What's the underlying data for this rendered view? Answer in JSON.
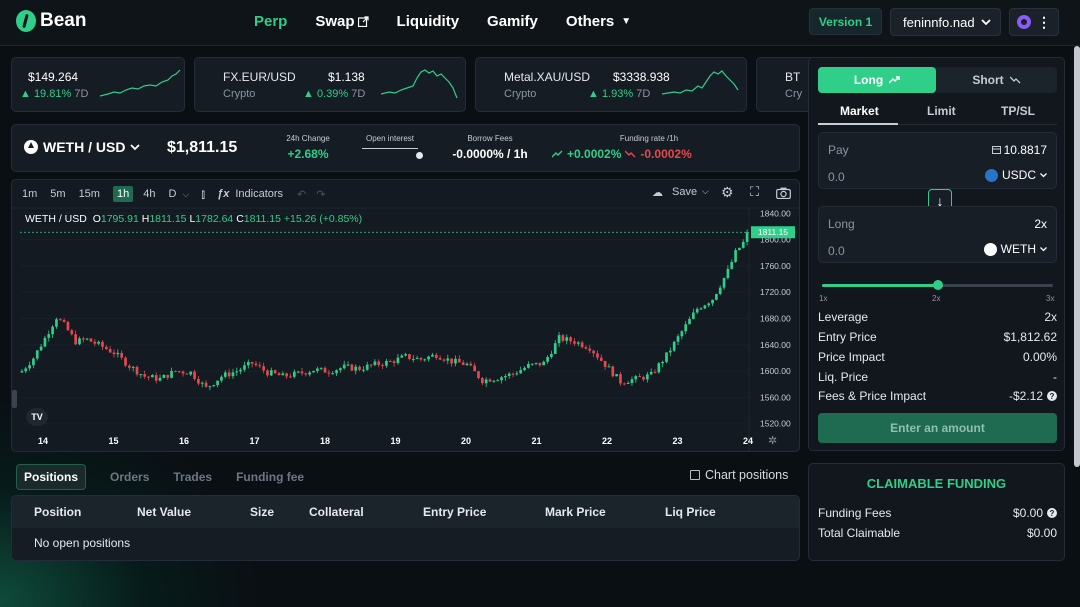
{
  "app": {
    "logo_text": "Bean"
  },
  "nav": {
    "items": [
      {
        "label": "Perp",
        "active": true
      },
      {
        "label": "Swap",
        "external": true
      },
      {
        "label": "Liquidity"
      },
      {
        "label": "Gamify"
      },
      {
        "label": "Others",
        "dropdown": true
      }
    ],
    "version": "Version 1",
    "account": "feninnfo.nad"
  },
  "tickers": [
    {
      "name": "",
      "price": "$149.264",
      "sub": "",
      "change": "▲ 19.81%",
      "period": "7D"
    },
    {
      "name": "FX.EUR/USD",
      "price": "$1.138",
      "sub": "Crypto",
      "change": "▲ 0.39%",
      "period": "7D"
    },
    {
      "name": "Metal.XAU/USD",
      "price": "$3338.938",
      "sub": "Crypto",
      "change": "▲ 1.93%",
      "period": "7D"
    },
    {
      "name": "BT",
      "price": "",
      "sub": "Cry",
      "change": "",
      "period": ""
    }
  ],
  "market": {
    "pair": "WETH / USD",
    "price": "$1,811.15",
    "stats": [
      {
        "label": "24h Change",
        "value": "+2.68%",
        "color": "#2fcf8a"
      },
      {
        "label": "Open interest",
        "value": ""
      },
      {
        "label": "Borrow Fees",
        "value": "-0.0000% / 1h",
        "color": "#ffffff"
      },
      {
        "label": "Funding rate /1h",
        "value_pos": "+0.0002%",
        "value_neg": "-0.0002%"
      }
    ]
  },
  "chart_toolbar": {
    "timeframes": [
      "1m",
      "5m",
      "15m",
      "1h",
      "4h",
      "D"
    ],
    "active_tf": "1h",
    "indicators_label": "Indicators",
    "save_label": "Save"
  },
  "chart_legend": {
    "symbol": "WETH / USD",
    "o_key": "O",
    "o": "1795.91",
    "h_key": "H",
    "h": "1811.15",
    "l_key": "L",
    "l": "1782.64",
    "c_key": "C",
    "c": "1811.15",
    "change": "+15.26 (+0.85%)"
  },
  "chart_data": {
    "type": "candlestick",
    "title": "WETH / USD",
    "x_ticks": [
      "14",
      "15",
      "16",
      "17",
      "18",
      "19",
      "20",
      "21",
      "22",
      "23",
      "24"
    ],
    "y_ticks": [
      1840,
      1800,
      1760,
      1720,
      1680,
      1640,
      1600,
      1560,
      1520
    ],
    "ylim": [
      1512,
      1848
    ],
    "last_price": 1811.15,
    "last_price_label": "1811.15",
    "close_path": [
      [
        0,
        1600
      ],
      [
        3,
        1620
      ],
      [
        6,
        1650
      ],
      [
        9,
        1682
      ],
      [
        11,
        1670
      ],
      [
        14,
        1645
      ],
      [
        17,
        1648
      ],
      [
        20,
        1640
      ],
      [
        24,
        1628
      ],
      [
        28,
        1608
      ],
      [
        32,
        1592
      ],
      [
        36,
        1588
      ],
      [
        40,
        1600
      ],
      [
        44,
        1598
      ],
      [
        48,
        1574
      ],
      [
        52,
        1592
      ],
      [
        56,
        1600
      ],
      [
        60,
        1612
      ],
      [
        64,
        1598
      ],
      [
        68,
        1592
      ],
      [
        72,
        1596
      ],
      [
        76,
        1602
      ],
      [
        80,
        1600
      ],
      [
        84,
        1606
      ],
      [
        88,
        1604
      ],
      [
        92,
        1610
      ],
      [
        96,
        1614
      ],
      [
        100,
        1622
      ],
      [
        104,
        1618
      ],
      [
        108,
        1625
      ],
      [
        112,
        1615
      ],
      [
        116,
        1610
      ],
      [
        120,
        1586
      ],
      [
        124,
        1590
      ],
      [
        128,
        1596
      ],
      [
        132,
        1608
      ],
      [
        136,
        1612
      ],
      [
        140,
        1650
      ],
      [
        144,
        1645
      ],
      [
        148,
        1636
      ],
      [
        152,
        1610
      ],
      [
        156,
        1584
      ],
      [
        160,
        1588
      ],
      [
        164,
        1594
      ],
      [
        168,
        1624
      ],
      [
        172,
        1660
      ],
      [
        176,
        1695
      ],
      [
        180,
        1710
      ],
      [
        184,
        1752
      ],
      [
        186,
        1780
      ],
      [
        188,
        1795
      ],
      [
        189,
        1811.15
      ]
    ],
    "candle_count": 190
  },
  "positions": {
    "tabs": [
      "Positions",
      "Orders",
      "Trades",
      "Funding fee"
    ],
    "active_tab": "Positions",
    "chart_positions_label": "Chart positions",
    "columns": [
      "Position",
      "Net Value",
      "Size",
      "Collateral",
      "Entry Price",
      "Mark Price",
      "Liq Price"
    ],
    "empty_text": "No open positions"
  },
  "trade": {
    "long_label": "Long",
    "short_label": "Short",
    "order_tabs": [
      "Market",
      "Limit",
      "TP/SL"
    ],
    "active_order_tab": "Market",
    "pay": {
      "label": "Pay",
      "balance": "10.8817",
      "amount": "0.0",
      "token": "USDC"
    },
    "long": {
      "label": "Long",
      "leverage": "2x",
      "amount": "0.0",
      "token": "WETH"
    },
    "leverage_fraction": 0.5,
    "slider_labels": [
      "1x",
      "2x",
      "3x"
    ],
    "rows": [
      {
        "label": "Leverage",
        "value": "2x"
      },
      {
        "label": "Entry Price",
        "value": "$1,812.62"
      },
      {
        "label": "Price Impact",
        "value": "0.00%"
      },
      {
        "label": "Liq. Price",
        "value": "-"
      },
      {
        "label": "Fees & Price Impact",
        "value": "-$2.12",
        "info": true
      }
    ],
    "submit_label": "Enter an amount"
  },
  "claim": {
    "title": "CLAIMABLE FUNDING",
    "rows": [
      {
        "label": "Funding Fees",
        "value": "$0.00",
        "info": true
      },
      {
        "label": "Total Claimable",
        "value": "$0.00"
      }
    ]
  },
  "colors": {
    "accent": "#2fcf8a",
    "down": "#e5484d",
    "bg": "#0b1016",
    "panel": "#151c23"
  }
}
